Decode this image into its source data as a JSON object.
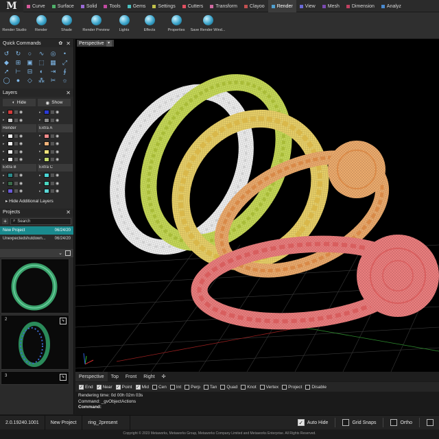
{
  "app": {
    "logo": "M"
  },
  "tabs": [
    {
      "label": "Curve",
      "color": "#d65a9a"
    },
    {
      "label": "Surface",
      "color": "#4fb06a"
    },
    {
      "label": "Solid",
      "color": "#9a6ad6"
    },
    {
      "label": "Tools",
      "color": "#c04aa0"
    },
    {
      "label": "Gems",
      "color": "#4ac0c0"
    },
    {
      "label": "Settings",
      "color": "#c0c04a"
    },
    {
      "label": "Cutters",
      "color": "#e05060"
    },
    {
      "label": "Transform",
      "color": "#d06aa0"
    },
    {
      "label": "Clayoo",
      "color": "#c05050"
    },
    {
      "label": "Render",
      "color": "#50a0d0"
    },
    {
      "label": "View",
      "color": "#6a6ad6"
    },
    {
      "label": "Mesh",
      "color": "#7a4ab0"
    },
    {
      "label": "Dimension",
      "color": "#c04060"
    },
    {
      "label": "Analyz",
      "color": "#4a8ad0"
    }
  ],
  "active_tab": "Render",
  "ribbon": [
    {
      "label": "Render Studio"
    },
    {
      "label": "Render"
    },
    {
      "label": "Shade"
    },
    {
      "label": "Render Preview"
    },
    {
      "label": "Lights"
    },
    {
      "label": "Effects"
    },
    {
      "label": "Properties"
    },
    {
      "label": "Save Render Wind..."
    }
  ],
  "quick_commands": {
    "title": "Quick Commands",
    "icons": [
      "arc-icon",
      "arc2-icon",
      "circle-icon",
      "curve-icon",
      "spiral-icon",
      "dot-icon",
      "node-icon",
      "group-icon",
      "box-icon",
      "extrude-icon",
      "grid-icon",
      "scale-icon",
      "arrow-icon",
      "ruler-icon",
      "mesh-icon",
      "revolve-icon",
      "rail-icon",
      "sweep-icon",
      "ring-icon",
      "sphere-icon",
      "gem-icon",
      "pave-icon",
      "cutter-icon",
      "render-icon"
    ]
  },
  "layers": {
    "title": "Layers",
    "hide_label": "Hide",
    "show_label": "Show",
    "rows": [
      {
        "left": {
          "name": "",
          "color": "#d23b3b"
        },
        "right": {
          "name": "",
          "color": "#2a3ad6"
        }
      },
      {
        "left": {
          "name": "",
          "color": "#c9c9c9"
        },
        "right": {
          "name": "",
          "color": "#8a8a8a"
        }
      },
      {
        "left": {
          "name": "Render",
          "color": "",
          "head": true
        },
        "right": {
          "name": "Extra A",
          "color": "",
          "head": true
        }
      },
      {
        "left": {
          "name": "",
          "color": "#f5f5f5"
        },
        "right": {
          "name": "",
          "color": "#f08a8a"
        }
      },
      {
        "left": {
          "name": "",
          "color": "#f5f5f5"
        },
        "right": {
          "name": "",
          "color": "#f0b27a"
        }
      },
      {
        "left": {
          "name": "",
          "color": "#f0f0f0"
        },
        "right": {
          "name": "",
          "color": "#ede07a"
        }
      },
      {
        "left": {
          "name": "",
          "color": "#e8e8e8"
        },
        "right": {
          "name": "",
          "color": "#c3d96a"
        }
      },
      {
        "left": {
          "name": "Extra B",
          "color": "",
          "head": true
        },
        "right": {
          "name": "Extra C",
          "color": "",
          "head": true
        }
      },
      {
        "left": {
          "name": "",
          "color": "#2a8a8a"
        },
        "right": {
          "name": "",
          "color": "#4ad6d6"
        }
      },
      {
        "left": {
          "name": "",
          "color": "#3a6a4a"
        },
        "right": {
          "name": "",
          "color": "#4ad6c0"
        }
      },
      {
        "left": {
          "name": "",
          "color": "#6a5ad6"
        },
        "right": {
          "name": "",
          "color": "#5ad6d6"
        }
      }
    ],
    "hide_additional": "Hide Additional Layers"
  },
  "projects": {
    "title": "Projects",
    "search_placeholder": "Search",
    "items": [
      {
        "name": "New Project",
        "date": "06/24/20",
        "selected": true
      },
      {
        "name": "Unexpectedshutdown...",
        "date": "06/24/20",
        "selected": false
      }
    ],
    "thumbs": [
      {
        "num": ""
      },
      {
        "num": "2"
      },
      {
        "num": "3"
      }
    ]
  },
  "viewport": {
    "label": "Perspective"
  },
  "view_tabs": [
    "Perspective",
    "Top",
    "Front",
    "Right"
  ],
  "osnaps": [
    {
      "label": "End",
      "on": true
    },
    {
      "label": "Near",
      "on": true
    },
    {
      "label": "Point",
      "on": true
    },
    {
      "label": "Mid",
      "on": true
    },
    {
      "label": "Cen",
      "on": false
    },
    {
      "label": "Int",
      "on": false
    },
    {
      "label": "Perp",
      "on": false
    },
    {
      "label": "Tan",
      "on": false
    },
    {
      "label": "Quad",
      "on": false
    },
    {
      "label": "Knot",
      "on": false
    },
    {
      "label": "Vertex",
      "on": false
    },
    {
      "label": "Project",
      "on": false
    },
    {
      "label": "Disable",
      "on": false
    }
  ],
  "command": {
    "line1": "Rendering time: 0d 00h 02m 03s",
    "line2": "Command: _gvObjectActions",
    "prompt": "Command:"
  },
  "status": {
    "version": "2.0.19240.1001",
    "project": "New Project",
    "file": "ring_2present",
    "auto_hide": "Auto Hide",
    "grid_snaps": "Grid Snaps",
    "ortho": "Ortho"
  },
  "copyright": "Copyright © 2023 Metaworks, Metaworks Group, Metaworks Company Limited and Metaworks Enterprise. All Rights Reserved."
}
